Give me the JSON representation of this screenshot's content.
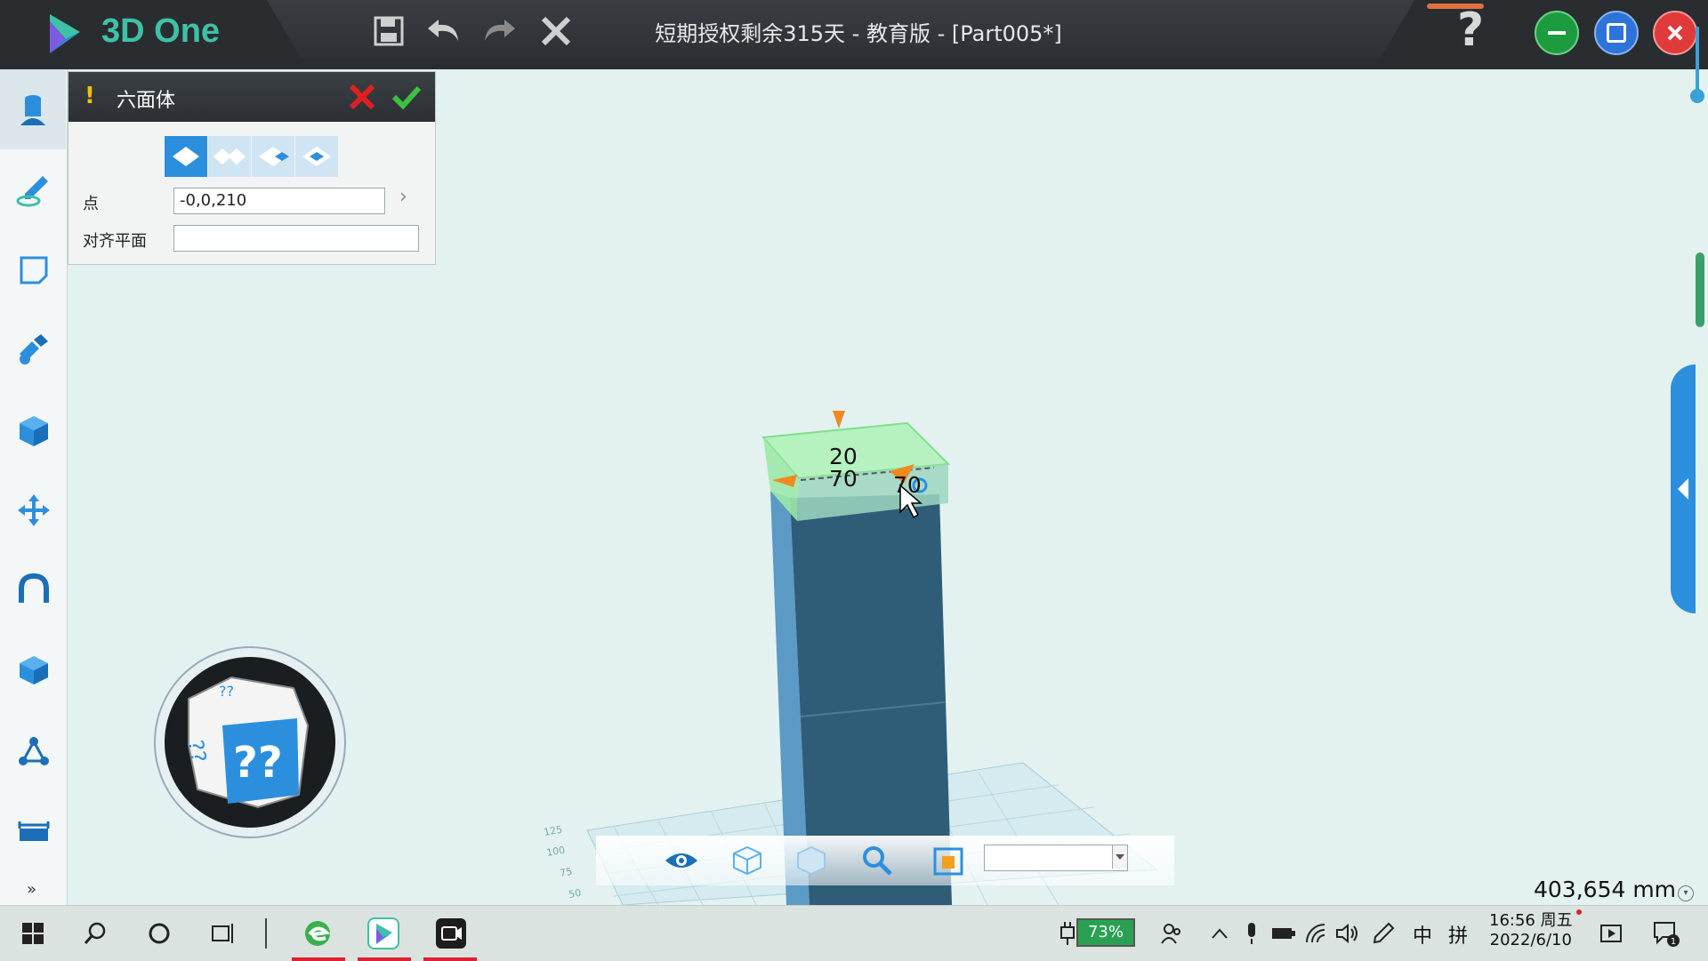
{
  "app": {
    "name": "3D One",
    "window_title": "短期授权剩余315天 - 教育版 - [Part005*]",
    "colors": {
      "brand": "#3fc1a7",
      "accent": "#2c8fde",
      "model": "#2f5d78",
      "highlight": "#8ff08a"
    }
  },
  "toolbar": {
    "save": "save-icon",
    "undo": "undo-icon",
    "redo": "redo-icon",
    "close": "close-icon",
    "help": "?"
  },
  "left_tools": [
    "basic-shapes-icon",
    "sketch-icon",
    "sketch-edit-icon",
    "special-features-icon",
    "combine-icon",
    "move-icon",
    "snap-icon",
    "pattern-icon",
    "delete-icon",
    "measure-icon",
    "more-icon"
  ],
  "left_tools_more": "»",
  "dialog": {
    "warning": "!",
    "title": "六面体",
    "point_label": "点",
    "point_value": "-0,0,210",
    "align_label": "对齐平面",
    "align_value": "",
    "arrow": "›"
  },
  "viewport": {
    "dim_height": "20",
    "dim_width": "70",
    "dim_depth": "70",
    "view_cube_text": "??",
    "grid_ticks": [
      "125",
      "100",
      "75",
      "50"
    ],
    "units_readout": "403,654 mm"
  },
  "taskbar": {
    "battery": "73%",
    "ime_lang": "中",
    "ime_mode": "拼",
    "time": "16:56 周五",
    "date": "2022/6/10",
    "notifications": "1"
  }
}
